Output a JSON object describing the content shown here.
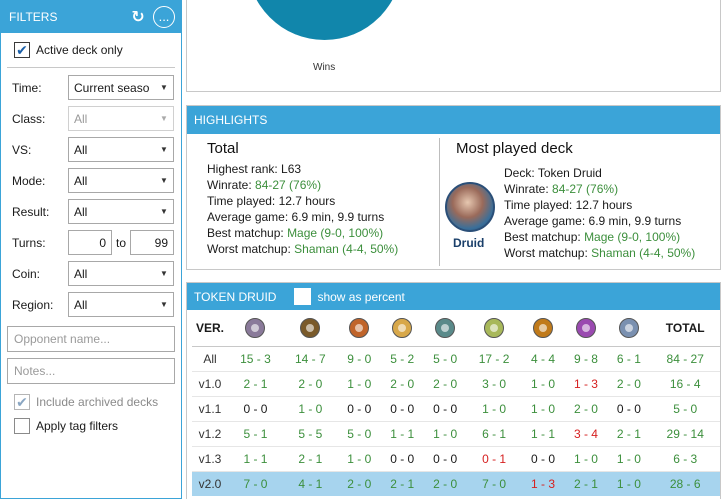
{
  "filters": {
    "title": "FILTERS",
    "refresh_icon": "refresh-icon",
    "more_label": "...",
    "active_deck_only": {
      "label": "Active deck only",
      "checked": true
    },
    "rows": [
      {
        "label": "Time:",
        "value": "Current seaso",
        "disabled": false
      },
      {
        "label": "Class:",
        "value": "All",
        "disabled": true
      },
      {
        "label": "VS:",
        "value": "All",
        "disabled": false
      },
      {
        "label": "Mode:",
        "value": "All",
        "disabled": false
      },
      {
        "label": "Result:",
        "value": "All",
        "disabled": false
      }
    ],
    "turns": {
      "label": "Turns:",
      "from": "0",
      "to_label": "to",
      "to": "99"
    },
    "rows2": [
      {
        "label": "Coin:",
        "value": "All"
      },
      {
        "label": "Region:",
        "value": "All"
      }
    ],
    "opponent_placeholder": "Opponent name...",
    "notes_placeholder": "Notes...",
    "include_archived": {
      "label": "Include archived decks",
      "checked": true,
      "disabled": true
    },
    "apply_tag_filters": {
      "label": "Apply tag filters",
      "checked": false
    }
  },
  "chart": {
    "wins_label": "Wins",
    "pie_color": "#1186ab"
  },
  "highlights": {
    "title": "HIGHLIGHTS",
    "total": {
      "heading": "Total",
      "highest_rank_label": "Highest rank:",
      "highest_rank": "L63",
      "winrate_label": "Winrate:",
      "winrate": "84-27 (76%)",
      "time_label": "Time played:",
      "time": "12.7 hours",
      "avg_label": "Average game:",
      "avg": "6.9 min, 9.9 turns",
      "best_label": "Best matchup:",
      "best": "Mage (9-0, 100%)",
      "worst_label": "Worst matchup:",
      "worst": "Shaman (4-4, 50%)"
    },
    "most_played": {
      "heading": "Most played deck",
      "deck_label": "Deck:",
      "deck": "Token Druid",
      "class_caption": "Druid",
      "winrate_label": "Winrate:",
      "winrate": "84-27 (76%)",
      "time_label": "Time played:",
      "time": "12.7 hours",
      "avg_label": "Average game:",
      "avg": "6.9 min, 9.9 turns",
      "best_label": "Best matchup:",
      "best": "Mage (9-0, 100%)",
      "worst_label": "Worst matchup:",
      "worst": "Shaman (4-4, 50%)"
    }
  },
  "token": {
    "title": "TOKEN DRUID",
    "show_percent_label": "show as percent",
    "ver_header": "VER.",
    "total_header": "TOTAL",
    "class_icons": [
      {
        "name": "druid-icon",
        "color": "#8a7a9a"
      },
      {
        "name": "hunter-icon",
        "color": "#7a5a2a"
      },
      {
        "name": "mage-icon",
        "color": "#c0642a"
      },
      {
        "name": "paladin-icon",
        "color": "#d8a84a"
      },
      {
        "name": "priest-icon",
        "color": "#5a8a8a"
      },
      {
        "name": "rogue-icon",
        "color": "#a8b85a"
      },
      {
        "name": "shaman-icon",
        "color": "#c07a1a"
      },
      {
        "name": "warlock-icon",
        "color": "#9a4ab0"
      },
      {
        "name": "warrior-icon",
        "color": "#7a90b0"
      }
    ],
    "rows": [
      {
        "ver": "All",
        "cells": [
          [
            "15 - 3",
            "g"
          ],
          [
            "14 - 7",
            "g"
          ],
          [
            "9 - 0",
            "g"
          ],
          [
            "5 - 2",
            "g"
          ],
          [
            "5 - 0",
            "g"
          ],
          [
            "17 - 2",
            "g"
          ],
          [
            "4 - 4",
            "g"
          ],
          [
            "9 - 8",
            "g"
          ],
          [
            "6 - 1",
            "g"
          ]
        ],
        "total": [
          "84 - 27",
          "g"
        ],
        "selected": false
      },
      {
        "ver": "v1.0",
        "cells": [
          [
            "2 - 1",
            "g"
          ],
          [
            "2 - 0",
            "g"
          ],
          [
            "1 - 0",
            "g"
          ],
          [
            "2 - 0",
            "g"
          ],
          [
            "2 - 0",
            "g"
          ],
          [
            "3 - 0",
            "g"
          ],
          [
            "1 - 0",
            "g"
          ],
          [
            "1 - 3",
            "r"
          ],
          [
            "2 - 0",
            "g"
          ]
        ],
        "total": [
          "16 - 4",
          "g"
        ],
        "selected": false
      },
      {
        "ver": "v1.1",
        "cells": [
          [
            "0 - 0",
            "n"
          ],
          [
            "1 - 0",
            "g"
          ],
          [
            "0 - 0",
            "n"
          ],
          [
            "0 - 0",
            "n"
          ],
          [
            "0 - 0",
            "n"
          ],
          [
            "1 - 0",
            "g"
          ],
          [
            "1 - 0",
            "g"
          ],
          [
            "2 - 0",
            "g"
          ],
          [
            "0 - 0",
            "n"
          ]
        ],
        "total": [
          "5 - 0",
          "g"
        ],
        "selected": false
      },
      {
        "ver": "v1.2",
        "cells": [
          [
            "5 - 1",
            "g"
          ],
          [
            "5 - 5",
            "g"
          ],
          [
            "5 - 0",
            "g"
          ],
          [
            "1 - 1",
            "g"
          ],
          [
            "1 - 0",
            "g"
          ],
          [
            "6 - 1",
            "g"
          ],
          [
            "1 - 1",
            "g"
          ],
          [
            "3 - 4",
            "r"
          ],
          [
            "2 - 1",
            "g"
          ]
        ],
        "total": [
          "29 - 14",
          "g"
        ],
        "selected": false
      },
      {
        "ver": "v1.3",
        "cells": [
          [
            "1 - 1",
            "g"
          ],
          [
            "2 - 1",
            "g"
          ],
          [
            "1 - 0",
            "g"
          ],
          [
            "0 - 0",
            "n"
          ],
          [
            "0 - 0",
            "n"
          ],
          [
            "0 - 1",
            "r"
          ],
          [
            "0 - 0",
            "n"
          ],
          [
            "1 - 0",
            "g"
          ],
          [
            "1 - 0",
            "g"
          ]
        ],
        "total": [
          "6 - 3",
          "g"
        ],
        "selected": false
      },
      {
        "ver": "v2.0",
        "cells": [
          [
            "7 - 0",
            "g"
          ],
          [
            "4 - 1",
            "g"
          ],
          [
            "2 - 0",
            "g"
          ],
          [
            "2 - 1",
            "g"
          ],
          [
            "2 - 0",
            "g"
          ],
          [
            "7 - 0",
            "g"
          ],
          [
            "1 - 3",
            "r"
          ],
          [
            "2 - 1",
            "g"
          ],
          [
            "1 - 0",
            "g"
          ]
        ],
        "total": [
          "28 - 6",
          "g"
        ],
        "selected": true
      }
    ]
  }
}
